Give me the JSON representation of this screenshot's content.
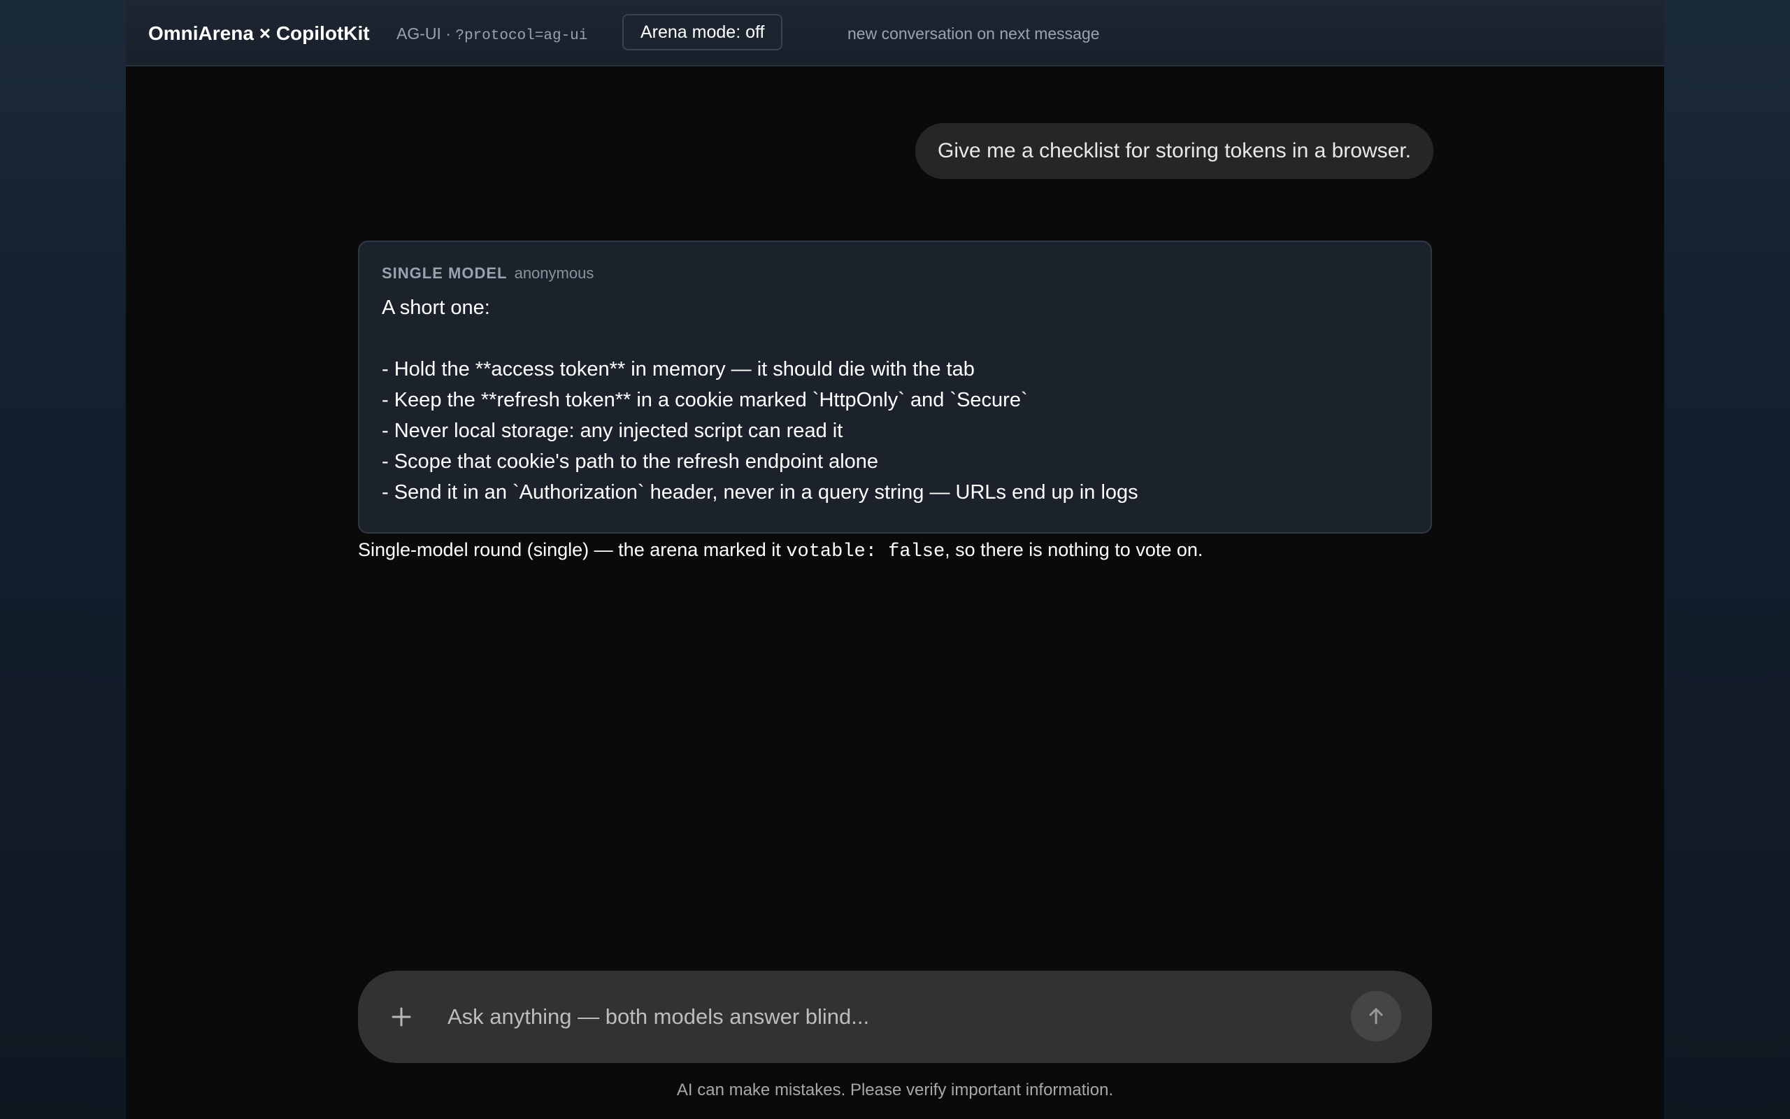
{
  "header": {
    "brand": "OmniArena × CopilotKit",
    "protocol_label": "AG-UI · ",
    "protocol_param": "?protocol=ag-ui",
    "arena_mode_button": "Arena mode: off",
    "hint": "new conversation on next message"
  },
  "conversation": {
    "user_message": "Give me a checklist for storing tokens in a browser.",
    "answer": {
      "tag": "SINGLE MODEL",
      "author": "anonymous",
      "intro": "A short one:",
      "lines": [
        "- Hold the **access token** in memory — it should die with the tab",
        "- Keep the **refresh token** in a cookie marked `HttpOnly` and `Secure`",
        "- Never local storage: any injected script can read it",
        "- Scope that cookie's path to the refresh endpoint alone",
        "- Send it in an `Authorization` header, never in a query string — URLs end up in logs"
      ]
    },
    "vote_note": {
      "before": "Single-model round (single) — the arena marked it ",
      "code": "votable: false",
      "after": ", so there is nothing to vote on."
    }
  },
  "composer": {
    "placeholder": "Ask anything — both models answer blind...",
    "value": "",
    "plus_icon": "plus-icon",
    "send_icon": "arrow-up-icon"
  },
  "footer": {
    "disclaimer": "AI can make mistakes. Please verify important information."
  },
  "colors": {
    "app_background": "#0a0a0a",
    "card_background": "#1c222b",
    "composer_background": "#323232",
    "user_bubble": "#262626"
  }
}
